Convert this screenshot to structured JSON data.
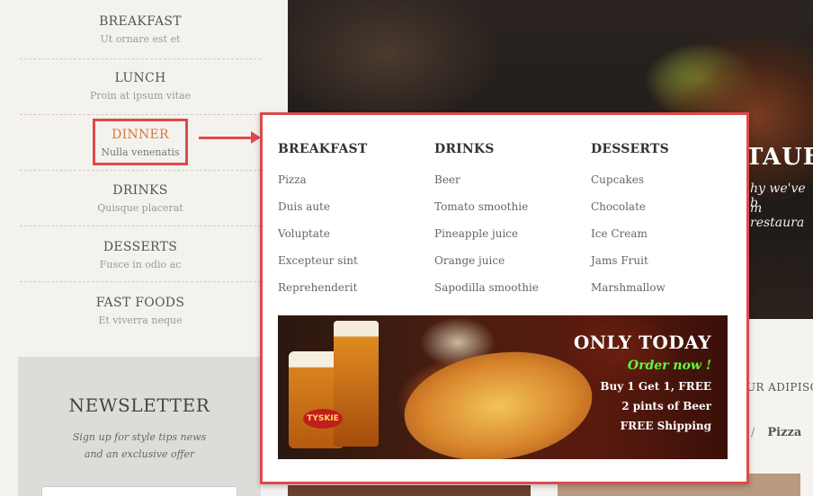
{
  "sidebar": {
    "items": [
      {
        "title": "BREAKFAST",
        "subtitle": "Ut ornare est et"
      },
      {
        "title": "LUNCH",
        "subtitle": "Proin at ipsum vitae"
      },
      {
        "title": "DINNER",
        "subtitle": "Nulla venenatis"
      },
      {
        "title": "DRINKS",
        "subtitle": "Quisque placerat"
      },
      {
        "title": "DESSERTS",
        "subtitle": "Fusce in odio ac"
      },
      {
        "title": "FAST FOODS",
        "subtitle": "Et viverra neque"
      }
    ]
  },
  "newsletter": {
    "title": "NEWSLETTER",
    "line1": "Sign up for style tips news",
    "line2": "and an exclusive offer"
  },
  "mega_menu": {
    "columns": [
      {
        "title": "BREAKFAST",
        "items": [
          "Pizza",
          "Duis aute",
          "Voluptate",
          "Excepteur sint",
          "Reprehenderit"
        ]
      },
      {
        "title": "DRINKS",
        "items": [
          "Beer",
          "Tomato smoothie",
          "Pineapple juice",
          "Orange juice",
          "Sapodilla smoothie"
        ]
      },
      {
        "title": "DESSERTS",
        "items": [
          "Cupcakes",
          "Chocolate",
          "Ice Cream",
          "Jams Fruit",
          "Marshmallow"
        ]
      }
    ],
    "promo": {
      "headline": "ONLY TODAY",
      "cta": "Order now !",
      "line1": "Buy 1 Get 1, FREE",
      "line2": "2 pints of Beer",
      "line3": "FREE Shipping",
      "brand": "TYSKIE"
    }
  },
  "background": {
    "hero_title": "TAUE",
    "hero_sub1": "hy we've b",
    "hero_sub2": "m restaura",
    "content_heading": "UR ADIPISCIN",
    "breadcrumb_sep": "/",
    "breadcrumb_current": "Pizza"
  },
  "colors": {
    "highlight": "#de4a4a",
    "active_item": "#d9773a",
    "order_now": "#5fff3a"
  }
}
